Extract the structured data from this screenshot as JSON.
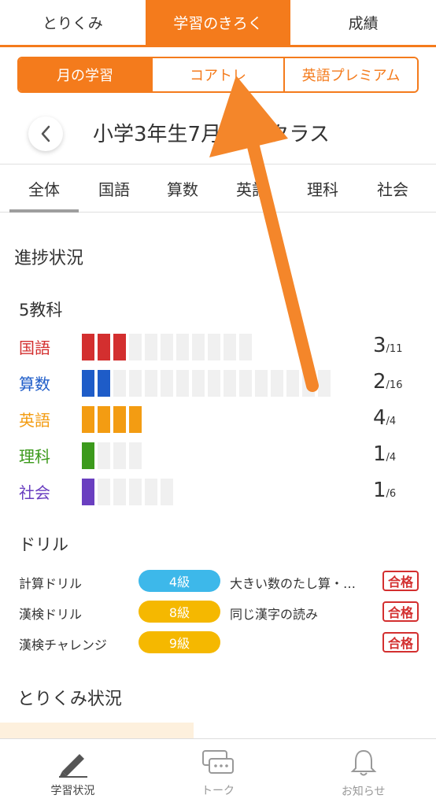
{
  "top_tabs": [
    "とりくみ",
    "学習のきろく",
    "成績"
  ],
  "segments": [
    "月の学習",
    "コアトレ",
    "英語プレミアム"
  ],
  "header": {
    "title": "小学3年生7月 発展クラス"
  },
  "subject_tabs": [
    "全体",
    "国語",
    "算数",
    "英語",
    "理科",
    "社会"
  ],
  "progress": {
    "title": "進捗状況",
    "group_title": "5教科",
    "subjects": [
      {
        "name": "国語",
        "done": 3,
        "total": 11,
        "done_text": "3",
        "total_text": "/11",
        "color": "#d32f2f"
      },
      {
        "name": "算数",
        "done": 2,
        "total": 16,
        "done_text": "2",
        "total_text": "/16",
        "color": "#1e5cc8"
      },
      {
        "name": "英語",
        "done": 4,
        "total": 4,
        "done_text": "4",
        "total_text": "/4",
        "color": "#f39c12"
      },
      {
        "name": "理科",
        "done": 1,
        "total": 4,
        "done_text": "1",
        "total_text": "/4",
        "color": "#3c9a1c"
      },
      {
        "name": "社会",
        "done": 1,
        "total": 6,
        "done_text": "1",
        "total_text": "/6",
        "color": "#6a3fc0"
      }
    ]
  },
  "drill": {
    "title": "ドリル",
    "rows": [
      {
        "name": "計算ドリル",
        "grade": "4級",
        "grade_color": "#3db8ea",
        "task": "大きい数のたし算・…",
        "badge": "合格"
      },
      {
        "name": "漢検ドリル",
        "grade": "8級",
        "grade_color": "#f5b800",
        "task": "同じ漢字の読み",
        "badge": "合格"
      },
      {
        "name": "漢検チャレンジ",
        "grade": "9級",
        "grade_color": "#f5b800",
        "task": "",
        "badge": "合格"
      }
    ]
  },
  "activity": {
    "title": "とりくみ状況"
  },
  "bottom_nav": [
    {
      "label": "学習状況",
      "icon": "pencil-icon"
    },
    {
      "label": "トーク",
      "icon": "chat-icon"
    },
    {
      "label": "お知らせ",
      "icon": "bell-icon"
    }
  ],
  "colors": {
    "accent": "#f47b1c",
    "annotation_arrow": "#f4862a",
    "badge_red": "#d32f2f"
  }
}
